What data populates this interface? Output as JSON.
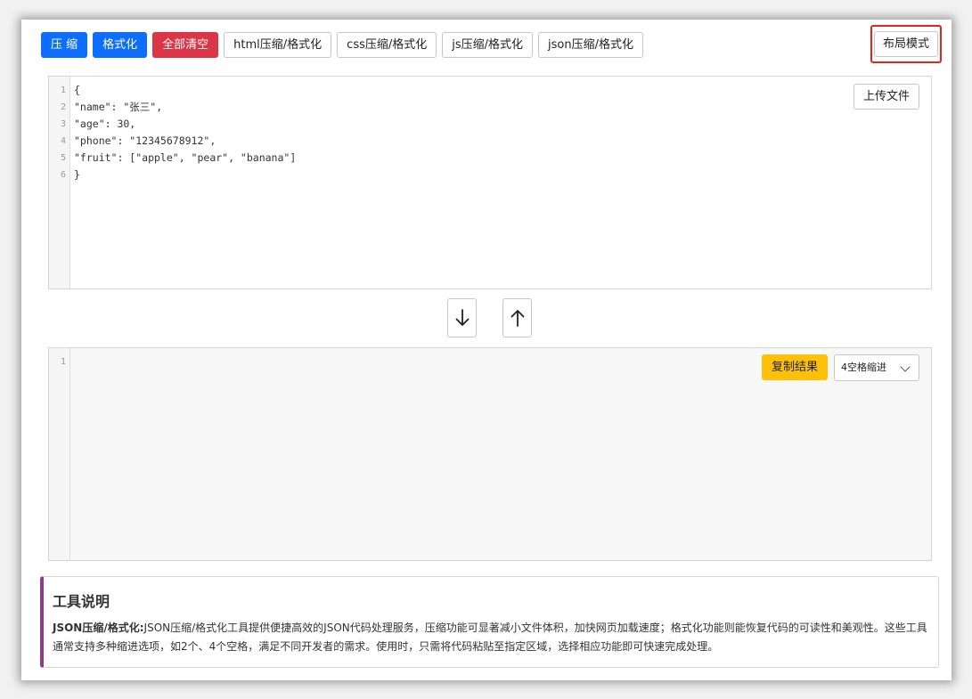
{
  "toolbar": {
    "compress_label": "压 缩",
    "format_label": "格式化",
    "clear_label": "全部清空",
    "html_label": "html压缩/格式化",
    "css_label": "css压缩/格式化",
    "js_label": "js压缩/格式化",
    "json_label": "json压缩/格式化",
    "layout_label": "布局模式"
  },
  "input": {
    "upload_label": "上传文件",
    "line_numbers": [
      "1",
      "2",
      "3",
      "4",
      "5",
      "6"
    ],
    "lines": [
      "{",
      "\"name\": \"张三\",",
      "\"age\": 30,",
      "\"phone\": \"12345678912\",",
      "\"fruit\": [\"apple\", \"pear\", \"banana\"]",
      "}"
    ]
  },
  "output": {
    "copy_label": "复制结果",
    "indent_selected": "4空格缩进",
    "line_numbers": [
      "1"
    ]
  },
  "description": {
    "heading": "工具说明",
    "lead": "JSON压缩/格式化:",
    "body": "JSON压缩/格式化工具提供便捷高效的JSON代码处理服务，压缩功能可显著减小文件体积，加快网页加载速度；格式化功能则能恢复代码的可读性和美观性。这些工具通常支持多种缩进选项，如2个、4个空格，满足不同开发者的需求。使用时，只需将代码粘贴至指定区域，选择相应功能即可快速完成处理。"
  },
  "colors": {
    "primary": "#0d6efd",
    "danger": "#dc3545",
    "warning": "#ffc107",
    "highlight_border": "#e0261e",
    "description_accent": "#8d3a8a"
  },
  "icons": [
    "arrow-down-icon",
    "arrow-up-icon",
    "chevron-down-icon"
  ]
}
